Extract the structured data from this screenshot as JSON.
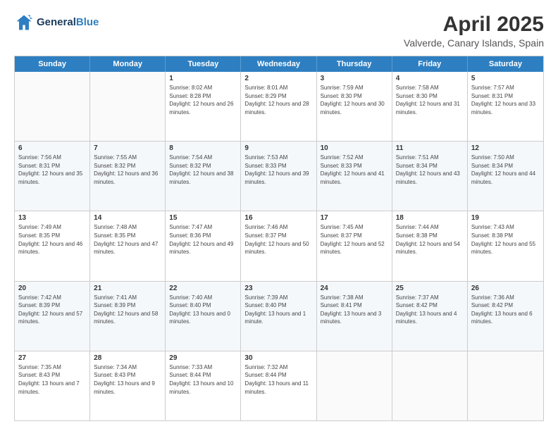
{
  "header": {
    "logo_general": "General",
    "logo_blue": "Blue",
    "title": "April 2025",
    "subtitle": "Valverde, Canary Islands, Spain"
  },
  "days_of_week": [
    "Sunday",
    "Monday",
    "Tuesday",
    "Wednesday",
    "Thursday",
    "Friday",
    "Saturday"
  ],
  "weeks": [
    [
      {
        "day": "",
        "sunrise": "",
        "sunset": "",
        "daylight": ""
      },
      {
        "day": "",
        "sunrise": "",
        "sunset": "",
        "daylight": ""
      },
      {
        "day": "1",
        "sunrise": "Sunrise: 8:02 AM",
        "sunset": "Sunset: 8:28 PM",
        "daylight": "Daylight: 12 hours and 26 minutes."
      },
      {
        "day": "2",
        "sunrise": "Sunrise: 8:01 AM",
        "sunset": "Sunset: 8:29 PM",
        "daylight": "Daylight: 12 hours and 28 minutes."
      },
      {
        "day": "3",
        "sunrise": "Sunrise: 7:59 AM",
        "sunset": "Sunset: 8:30 PM",
        "daylight": "Daylight: 12 hours and 30 minutes."
      },
      {
        "day": "4",
        "sunrise": "Sunrise: 7:58 AM",
        "sunset": "Sunset: 8:30 PM",
        "daylight": "Daylight: 12 hours and 31 minutes."
      },
      {
        "day": "5",
        "sunrise": "Sunrise: 7:57 AM",
        "sunset": "Sunset: 8:31 PM",
        "daylight": "Daylight: 12 hours and 33 minutes."
      }
    ],
    [
      {
        "day": "6",
        "sunrise": "Sunrise: 7:56 AM",
        "sunset": "Sunset: 8:31 PM",
        "daylight": "Daylight: 12 hours and 35 minutes."
      },
      {
        "day": "7",
        "sunrise": "Sunrise: 7:55 AM",
        "sunset": "Sunset: 8:32 PM",
        "daylight": "Daylight: 12 hours and 36 minutes."
      },
      {
        "day": "8",
        "sunrise": "Sunrise: 7:54 AM",
        "sunset": "Sunset: 8:32 PM",
        "daylight": "Daylight: 12 hours and 38 minutes."
      },
      {
        "day": "9",
        "sunrise": "Sunrise: 7:53 AM",
        "sunset": "Sunset: 8:33 PM",
        "daylight": "Daylight: 12 hours and 39 minutes."
      },
      {
        "day": "10",
        "sunrise": "Sunrise: 7:52 AM",
        "sunset": "Sunset: 8:33 PM",
        "daylight": "Daylight: 12 hours and 41 minutes."
      },
      {
        "day": "11",
        "sunrise": "Sunrise: 7:51 AM",
        "sunset": "Sunset: 8:34 PM",
        "daylight": "Daylight: 12 hours and 43 minutes."
      },
      {
        "day": "12",
        "sunrise": "Sunrise: 7:50 AM",
        "sunset": "Sunset: 8:34 PM",
        "daylight": "Daylight: 12 hours and 44 minutes."
      }
    ],
    [
      {
        "day": "13",
        "sunrise": "Sunrise: 7:49 AM",
        "sunset": "Sunset: 8:35 PM",
        "daylight": "Daylight: 12 hours and 46 minutes."
      },
      {
        "day": "14",
        "sunrise": "Sunrise: 7:48 AM",
        "sunset": "Sunset: 8:35 PM",
        "daylight": "Daylight: 12 hours and 47 minutes."
      },
      {
        "day": "15",
        "sunrise": "Sunrise: 7:47 AM",
        "sunset": "Sunset: 8:36 PM",
        "daylight": "Daylight: 12 hours and 49 minutes."
      },
      {
        "day": "16",
        "sunrise": "Sunrise: 7:46 AM",
        "sunset": "Sunset: 8:37 PM",
        "daylight": "Daylight: 12 hours and 50 minutes."
      },
      {
        "day": "17",
        "sunrise": "Sunrise: 7:45 AM",
        "sunset": "Sunset: 8:37 PM",
        "daylight": "Daylight: 12 hours and 52 minutes."
      },
      {
        "day": "18",
        "sunrise": "Sunrise: 7:44 AM",
        "sunset": "Sunset: 8:38 PM",
        "daylight": "Daylight: 12 hours and 54 minutes."
      },
      {
        "day": "19",
        "sunrise": "Sunrise: 7:43 AM",
        "sunset": "Sunset: 8:38 PM",
        "daylight": "Daylight: 12 hours and 55 minutes."
      }
    ],
    [
      {
        "day": "20",
        "sunrise": "Sunrise: 7:42 AM",
        "sunset": "Sunset: 8:39 PM",
        "daylight": "Daylight: 12 hours and 57 minutes."
      },
      {
        "day": "21",
        "sunrise": "Sunrise: 7:41 AM",
        "sunset": "Sunset: 8:39 PM",
        "daylight": "Daylight: 12 hours and 58 minutes."
      },
      {
        "day": "22",
        "sunrise": "Sunrise: 7:40 AM",
        "sunset": "Sunset: 8:40 PM",
        "daylight": "Daylight: 13 hours and 0 minutes."
      },
      {
        "day": "23",
        "sunrise": "Sunrise: 7:39 AM",
        "sunset": "Sunset: 8:40 PM",
        "daylight": "Daylight: 13 hours and 1 minute."
      },
      {
        "day": "24",
        "sunrise": "Sunrise: 7:38 AM",
        "sunset": "Sunset: 8:41 PM",
        "daylight": "Daylight: 13 hours and 3 minutes."
      },
      {
        "day": "25",
        "sunrise": "Sunrise: 7:37 AM",
        "sunset": "Sunset: 8:42 PM",
        "daylight": "Daylight: 13 hours and 4 minutes."
      },
      {
        "day": "26",
        "sunrise": "Sunrise: 7:36 AM",
        "sunset": "Sunset: 8:42 PM",
        "daylight": "Daylight: 13 hours and 6 minutes."
      }
    ],
    [
      {
        "day": "27",
        "sunrise": "Sunrise: 7:35 AM",
        "sunset": "Sunset: 8:43 PM",
        "daylight": "Daylight: 13 hours and 7 minutes."
      },
      {
        "day": "28",
        "sunrise": "Sunrise: 7:34 AM",
        "sunset": "Sunset: 8:43 PM",
        "daylight": "Daylight: 13 hours and 9 minutes."
      },
      {
        "day": "29",
        "sunrise": "Sunrise: 7:33 AM",
        "sunset": "Sunset: 8:44 PM",
        "daylight": "Daylight: 13 hours and 10 minutes."
      },
      {
        "day": "30",
        "sunrise": "Sunrise: 7:32 AM",
        "sunset": "Sunset: 8:44 PM",
        "daylight": "Daylight: 13 hours and 11 minutes."
      },
      {
        "day": "",
        "sunrise": "",
        "sunset": "",
        "daylight": ""
      },
      {
        "day": "",
        "sunrise": "",
        "sunset": "",
        "daylight": ""
      },
      {
        "day": "",
        "sunrise": "",
        "sunset": "",
        "daylight": ""
      }
    ]
  ]
}
